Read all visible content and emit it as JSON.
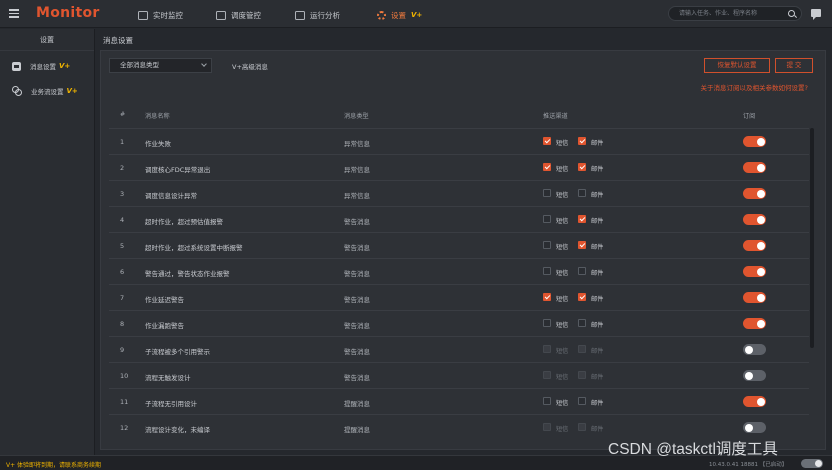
{
  "topbar": {
    "brand": "Monitor",
    "nav": [
      {
        "label": "实时监控",
        "icon": "monitor-icon"
      },
      {
        "label": "调度管控",
        "icon": "control-icon"
      },
      {
        "label": "运行分析",
        "icon": "chart-icon"
      },
      {
        "label": "设置",
        "icon": "gear-icon",
        "badge": "V+",
        "active": true
      }
    ],
    "search_placeholder": "请输入任务、作业、程序名称"
  },
  "sidebar": {
    "title": "设置",
    "items": [
      {
        "label": "消息设置",
        "badge": "V+",
        "icon": "message-icon"
      },
      {
        "label": "业务流设置",
        "badge": "V+",
        "icon": "link-icon"
      }
    ]
  },
  "main": {
    "title": "消息设置",
    "type_select": "全部消息类型",
    "advanced": "V+高级消息",
    "reset_button": "恢复默认设置",
    "submit_button": "提 交",
    "help_link": "关于消息订阅以及相关参数如何设置?",
    "columns": [
      "#",
      "消息名称",
      "消息类型",
      "推送渠道",
      "订阅"
    ],
    "channel_labels": {
      "sms": "短信",
      "mail": "邮件"
    },
    "rows": [
      {
        "num": "1",
        "name": "作业失败",
        "type": "异常信息",
        "sms": true,
        "mail": true,
        "sms_disabled": false,
        "subscribed": true
      },
      {
        "num": "2",
        "name": "调度核心FDC异常退出",
        "type": "异常信息",
        "sms": true,
        "mail": true,
        "sms_disabled": false,
        "subscribed": true
      },
      {
        "num": "3",
        "name": "调度信息设计异常",
        "type": "异常信息",
        "sms": false,
        "mail": false,
        "sms_disabled": false,
        "subscribed": true
      },
      {
        "num": "4",
        "name": "超时作业，超过预估值报警",
        "type": "警告消息",
        "sms": false,
        "mail": true,
        "sms_disabled": false,
        "subscribed": true
      },
      {
        "num": "5",
        "name": "超时作业，超过系统设置中断报警",
        "type": "警告消息",
        "sms": false,
        "mail": true,
        "sms_disabled": false,
        "subscribed": true
      },
      {
        "num": "6",
        "name": "警告通过，警告状态作业报警",
        "type": "警告消息",
        "sms": false,
        "mail": false,
        "sms_disabled": false,
        "subscribed": true
      },
      {
        "num": "7",
        "name": "作业延迟警告",
        "type": "警告消息",
        "sms": true,
        "mail": true,
        "sms_disabled": false,
        "subscribed": true
      },
      {
        "num": "8",
        "name": "作业漏跑警告",
        "type": "警告消息",
        "sms": false,
        "mail": false,
        "sms_disabled": false,
        "subscribed": true
      },
      {
        "num": "9",
        "name": "子流程被多个引用警示",
        "type": "警告消息",
        "sms": false,
        "mail": false,
        "sms_disabled": true,
        "subscribed": false
      },
      {
        "num": "10",
        "name": "流程无触发设计",
        "type": "警告消息",
        "sms": false,
        "mail": false,
        "sms_disabled": true,
        "subscribed": false
      },
      {
        "num": "11",
        "name": "子流程无引用设计",
        "type": "提醒消息",
        "sms": false,
        "mail": false,
        "sms_disabled": false,
        "subscribed": true
      },
      {
        "num": "12",
        "name": "流程设计变化，未编译",
        "type": "提醒消息",
        "sms": false,
        "mail": false,
        "sms_disabled": true,
        "subscribed": false
      }
    ]
  },
  "statusbar": {
    "left": "V+ 体验即将到期，请联系商务续期",
    "right": "10.43.0.41 18881 【已启动】"
  },
  "watermark": "CSDN @taskctl调度工具",
  "colors": {
    "accent": "#e0552f",
    "badge": "#f0b400",
    "background": "#25282d"
  }
}
